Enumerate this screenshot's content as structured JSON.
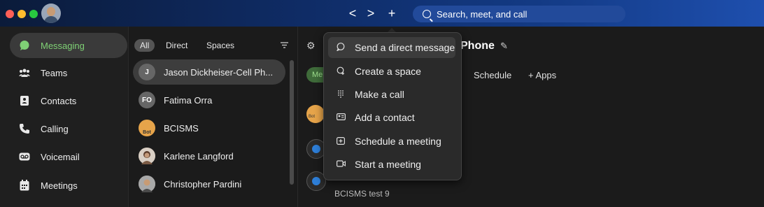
{
  "titlebar": {
    "back": "<",
    "forward": ">",
    "plus": "+",
    "search_placeholder": "Search, meet, and call"
  },
  "nav": {
    "items": [
      {
        "label": "Messaging",
        "icon": "chat-bubble-icon"
      },
      {
        "label": "Teams",
        "icon": "teams-icon"
      },
      {
        "label": "Contacts",
        "icon": "contacts-icon"
      },
      {
        "label": "Calling",
        "icon": "phone-icon"
      },
      {
        "label": "Voicemail",
        "icon": "voicemail-icon"
      },
      {
        "label": "Meetings",
        "icon": "calendar-icon"
      }
    ]
  },
  "filters": {
    "all": "All",
    "direct": "Direct",
    "spaces": "Spaces"
  },
  "contacts": [
    {
      "name": "Jason Dickheiser-Cell Ph...",
      "initials": "J"
    },
    {
      "name": "Fatima Orra",
      "initials": "FO"
    },
    {
      "name": "BCISMS",
      "initials": "Bot"
    },
    {
      "name": "Karlene Langford",
      "initials": ""
    },
    {
      "name": "Christopher Pardini",
      "initials": ""
    }
  ],
  "header": {
    "title_fragment": "Phone",
    "tab_hint": "Me",
    "tabs": [
      "Schedule",
      "+ Apps"
    ]
  },
  "menu": {
    "items": [
      {
        "label": "Send a direct message",
        "icon": "message-icon"
      },
      {
        "label": "Create a space",
        "icon": "create-space-icon"
      },
      {
        "label": "Make a call",
        "icon": "dialpad-icon"
      },
      {
        "label": "Add a contact",
        "icon": "contact-card-icon"
      },
      {
        "label": "Schedule a meeting",
        "icon": "schedule-icon"
      },
      {
        "label": "Start a meeting",
        "icon": "video-icon"
      }
    ]
  },
  "messages": {
    "bot_badge": "Bot",
    "preview": "BCISMS test 9"
  },
  "colors": {
    "accent_green": "#7fd175",
    "titlebar_blue": "#133a84"
  }
}
